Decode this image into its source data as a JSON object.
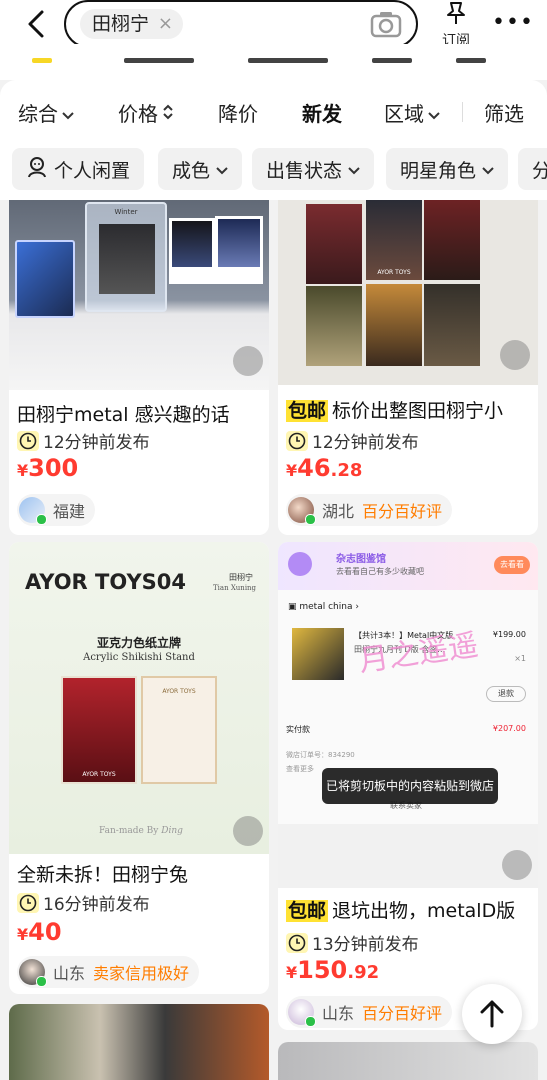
{
  "search": {
    "query": "田栩宁",
    "clear": "×"
  },
  "header": {
    "subscribe_label": "订阅",
    "more": "•••"
  },
  "sort_tabs": [
    {
      "label": "综合",
      "arrow": "⌄"
    },
    {
      "label": "价格",
      "arrow": "⇕"
    },
    {
      "label": "降价",
      "arrow": ""
    },
    {
      "label": "新发",
      "arrow": ""
    },
    {
      "label": "区域",
      "arrow": "⌄"
    },
    {
      "label": "筛选",
      "arrow": ""
    }
  ],
  "filters": [
    {
      "label": "个人闲置"
    },
    {
      "label": "成色"
    },
    {
      "label": "出售状态"
    },
    {
      "label": "明星角色"
    },
    {
      "label": "分"
    }
  ],
  "cards": [
    {
      "title": "田栩宁metal 感兴趣的话",
      "tag": "",
      "time": "12分钟前发布",
      "price_cur": "¥",
      "price_int": "300",
      "price_dec": "",
      "location": "福建",
      "credit": ""
    },
    {
      "title": "标价出整图田栩宁小",
      "tag": "包邮",
      "time": "12分钟前发布",
      "price_cur": "¥",
      "price_int": "46",
      "price_dec": ".28",
      "location": "湖北",
      "credit": "百分百好评"
    },
    {
      "title": "全新未拆！田栩宁兔",
      "tag": "",
      "time": "16分钟前发布",
      "price_cur": "¥",
      "price_int": "40",
      "price_dec": "",
      "location": "山东",
      "credit": "卖家信用极好"
    },
    {
      "title": "退坑出物，metalD版",
      "tag": "包邮",
      "time": "13分钟前发布",
      "price_cur": "¥",
      "price_int": "150",
      "price_dec": ".92",
      "location": "山东",
      "credit": "百分百好评"
    }
  ],
  "card_images": {
    "poster_brand": "AYOR TOYS04",
    "poster_name_cn": "田栩宁",
    "poster_name_en": "Tian Xuning",
    "poster_product_cn": "亚克力色纸立牌",
    "poster_product_en": "Acrylic Shikishi Stand",
    "poster_card_brand": "AYOR TOYS",
    "poster_fanmade": "Fan-made By",
    "poster_fanmade_sig": "Ding",
    "winter_label": "Winter",
    "photo_card_brand": "AYOR TOYS",
    "order_banner_title": "杂志图鉴馆",
    "order_banner_sub": "去看看自己有多少收藏吧",
    "order_banner_btn": "去看看",
    "order_shop": "metal china",
    "order_item_title": "【共计3本！】Metal中文版",
    "order_item_sub": "田栩宁九月刊 D版 含签…",
    "order_item_price": "¥199.00",
    "order_item_qty": "×1",
    "order_refund": "退款",
    "order_paid_label": "实付款",
    "order_paid_value": "¥207.00",
    "order_no_label": "微店订单号：834290",
    "order_more": "查看更多",
    "order_contact": "联系卖家",
    "watermark": "月之遥遥"
  },
  "toast": "已将剪切板中的内容粘贴到微店",
  "colors": {
    "price": "#ff3b30",
    "credit": "#ff7d00",
    "tag_bg": "#ffe233",
    "online": "#2bc048"
  }
}
